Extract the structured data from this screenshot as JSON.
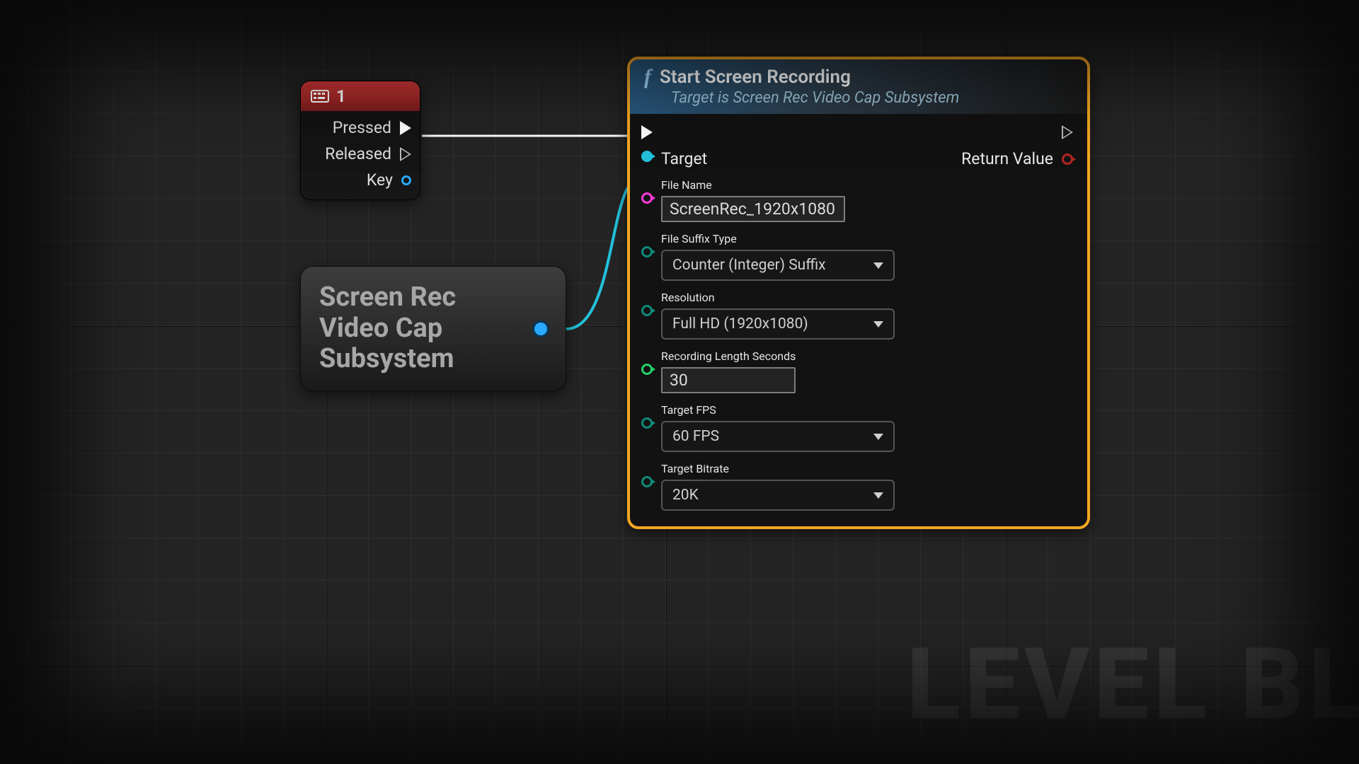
{
  "watermark": "LEVEL BL",
  "input_node": {
    "title": "1",
    "pressed": "Pressed",
    "released": "Released",
    "key": "Key"
  },
  "subsystem_node": {
    "line1": "Screen Rec",
    "line2": "Video Cap",
    "line3": "Subsystem"
  },
  "fn_node": {
    "title": "Start Screen Recording",
    "subtitle": "Target is Screen Rec Video Cap Subsystem",
    "target_label": "Target",
    "return_value_label": "Return Value",
    "params": {
      "file_name": {
        "label": "File Name",
        "value": "ScreenRec_1920x1080"
      },
      "file_suffix_type": {
        "label": "File Suffix Type",
        "value": "Counter (Integer) Suffix"
      },
      "resolution": {
        "label": "Resolution",
        "value": "Full HD (1920x1080)"
      },
      "recording_length_seconds": {
        "label": "Recording Length Seconds",
        "value": "30"
      },
      "target_fps": {
        "label": "Target FPS",
        "value": "60 FPS"
      },
      "target_bitrate": {
        "label": "Target Bitrate",
        "value": "20K"
      }
    }
  }
}
